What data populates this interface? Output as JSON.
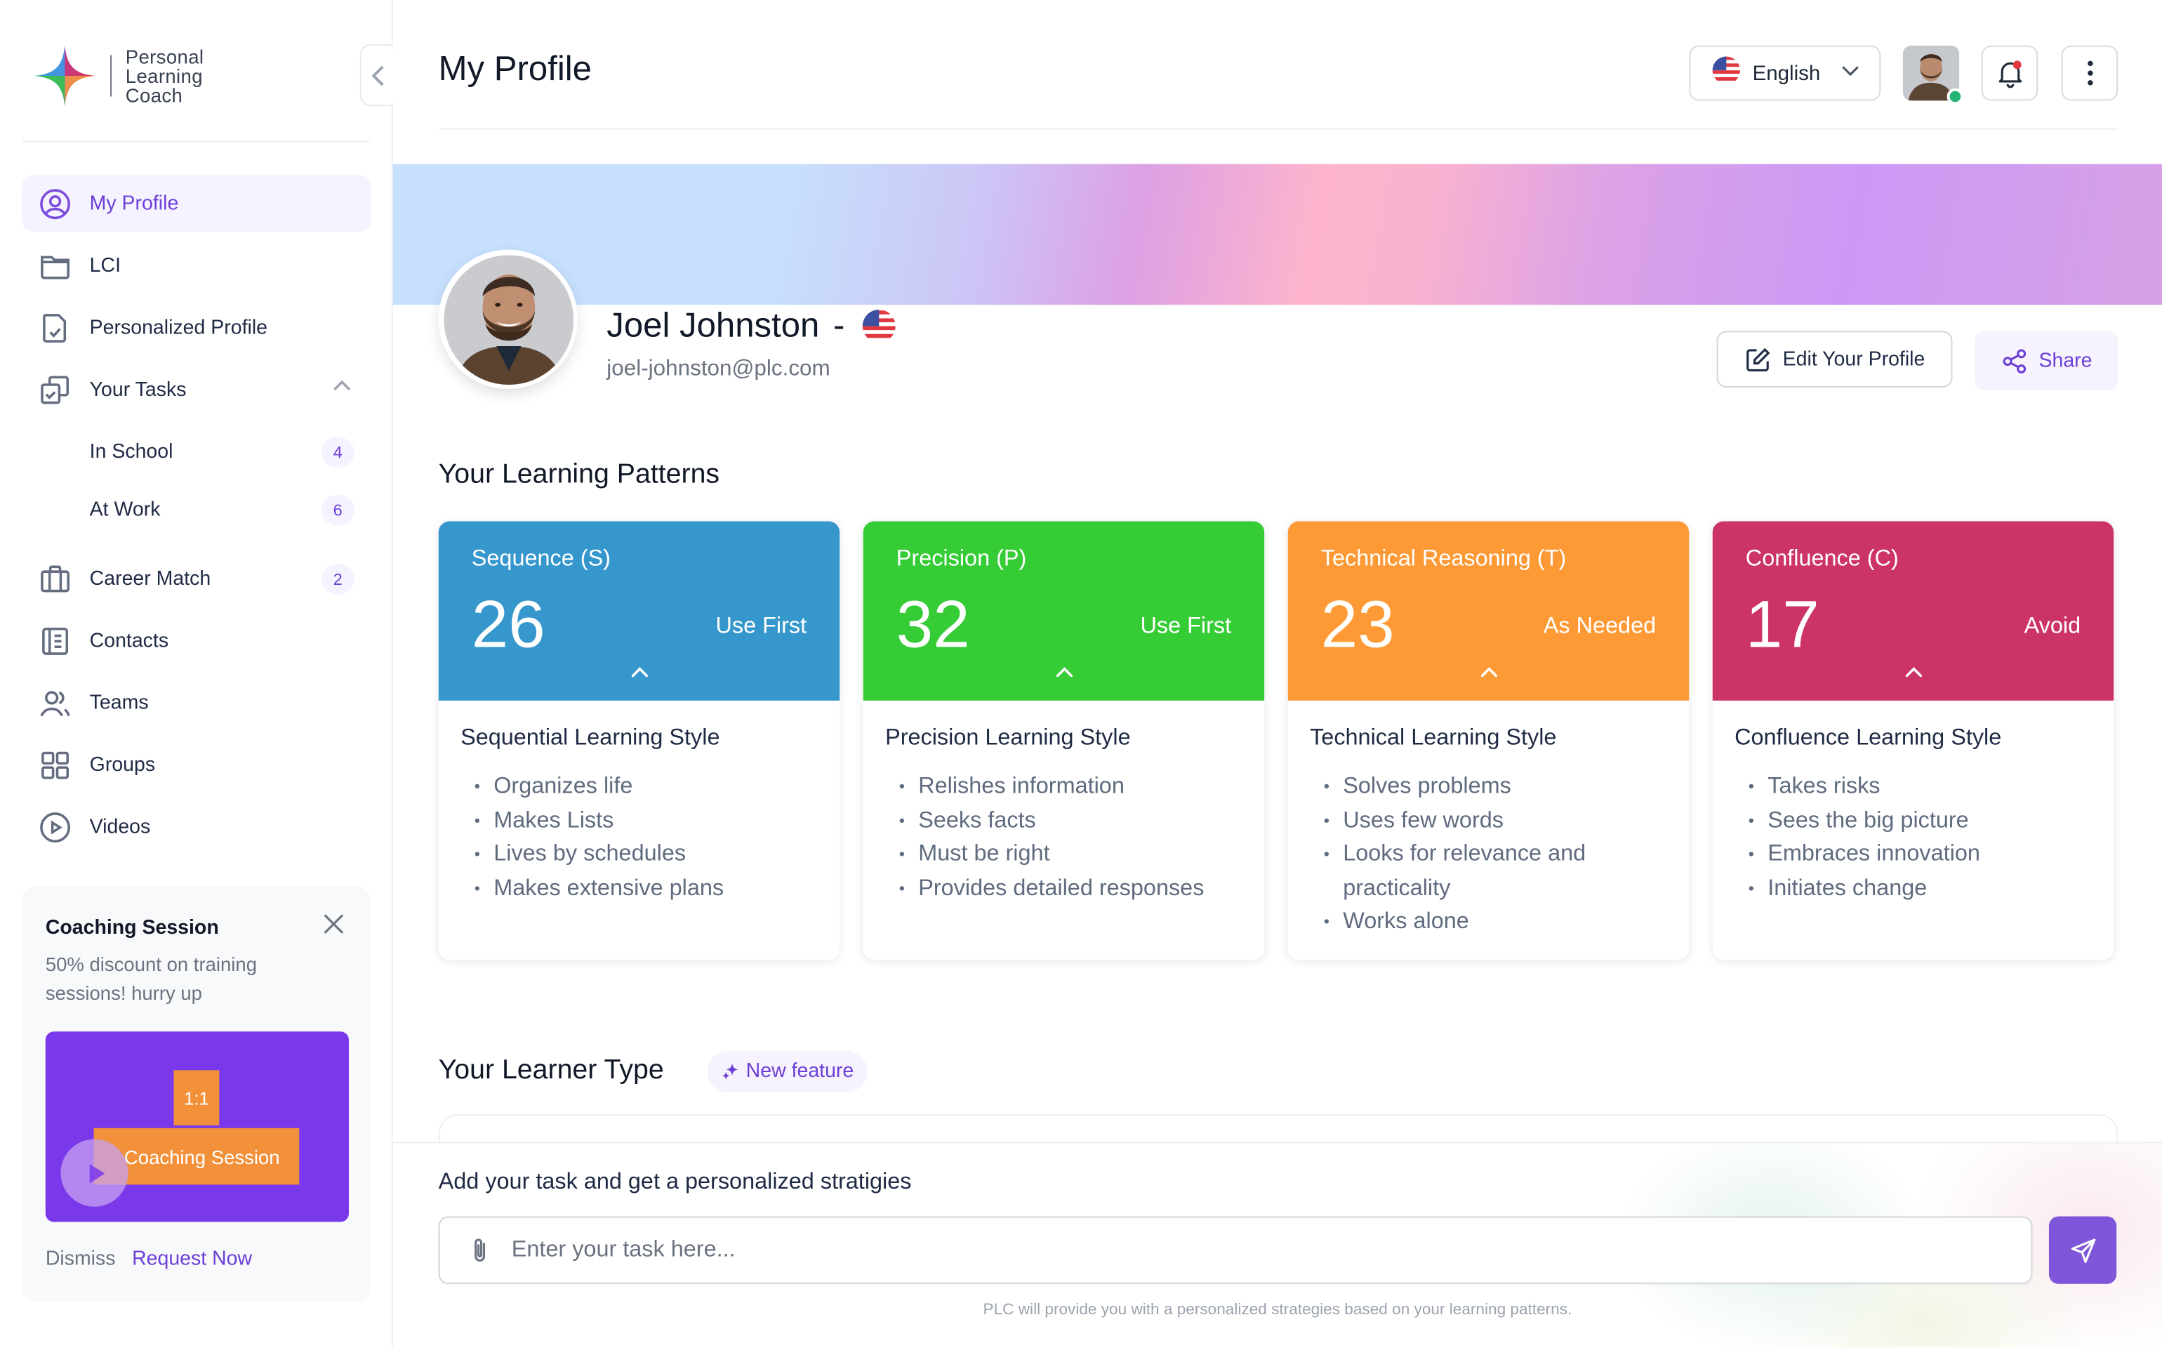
{
  "app": {
    "brand_lines": [
      "Personal",
      "Learning",
      "Coach"
    ]
  },
  "sidebar": {
    "items": [
      {
        "label": "My Profile",
        "icon": "user-circle-icon",
        "active": true
      },
      {
        "label": "LCI",
        "icon": "folder-icon"
      },
      {
        "label": "Personalized Profile",
        "icon": "file-check-icon"
      },
      {
        "label": "Your Tasks",
        "icon": "tasks-copy-icon",
        "expanded": true
      }
    ],
    "sub_items": [
      {
        "label": "In School",
        "count": "4"
      },
      {
        "label": "At Work",
        "count": "6"
      }
    ],
    "items2": [
      {
        "label": "Career Match",
        "icon": "briefcase-icon",
        "count": "2"
      },
      {
        "label": "Contacts",
        "icon": "contacts-book-icon"
      },
      {
        "label": "Teams",
        "icon": "users-icon"
      },
      {
        "label": "Groups",
        "icon": "grid-icon"
      },
      {
        "label": "Videos",
        "icon": "play-circle-icon"
      }
    ],
    "promo": {
      "title": "Coaching Session",
      "description": "50% discount on training sessions! hurry up",
      "video_tag": "1:1",
      "video_caption": "Coaching Session",
      "dismiss": "Dismiss",
      "request": "Request Now"
    }
  },
  "header": {
    "title": "My Profile",
    "language": "English"
  },
  "profile": {
    "name": "Joel Johnston",
    "separator": "-",
    "email": "joel-johnston@plc.com",
    "edit_label": "Edit Your Profile",
    "share_label": "Share"
  },
  "patterns": {
    "title": "Your Learning Patterns",
    "cards": [
      {
        "label": "Sequence (S)",
        "score": "26",
        "status": "Use First",
        "color": "#3597cc",
        "style_title": "Sequential Learning Style",
        "traits": [
          "Organizes life",
          "Makes Lists",
          "Lives by schedules",
          "Makes extensive plans"
        ]
      },
      {
        "label": "Precision (P)",
        "score": "32",
        "status": "Use First",
        "color": "#36cc36",
        "style_title": "Precision Learning Style",
        "traits": [
          "Relishes information",
          "Seeks facts",
          "Must be right",
          "Provides detailed responses"
        ]
      },
      {
        "label": "Technical Reasoning (T)",
        "score": "23",
        "status": "As Needed",
        "color": "#fd9a36",
        "style_title": "Technical Learning Style",
        "traits": [
          "Solves problems",
          "Uses few words",
          "Looks for relevance and practicality",
          "Works alone"
        ]
      },
      {
        "label": "Confluence (C)",
        "score": "17",
        "status": "Avoid",
        "color": "#cc3466",
        "style_title": "Confluence Learning Style",
        "traits": [
          "Takes risks",
          "Sees the big picture",
          "Embraces innovation",
          "Initiates change"
        ]
      }
    ]
  },
  "learner_type": {
    "title": "Your Learner Type",
    "badge": "New feature"
  },
  "task": {
    "label": "Add your task and get a personalized stratigies",
    "placeholder": "Enter your task here...",
    "value": "",
    "hint": "PLC will provide you with a personalized strategies based on your learning patterns."
  },
  "colors": {
    "accent": "#6d3fd6",
    "send_button": "#7f56d9",
    "online": "#22b573"
  }
}
